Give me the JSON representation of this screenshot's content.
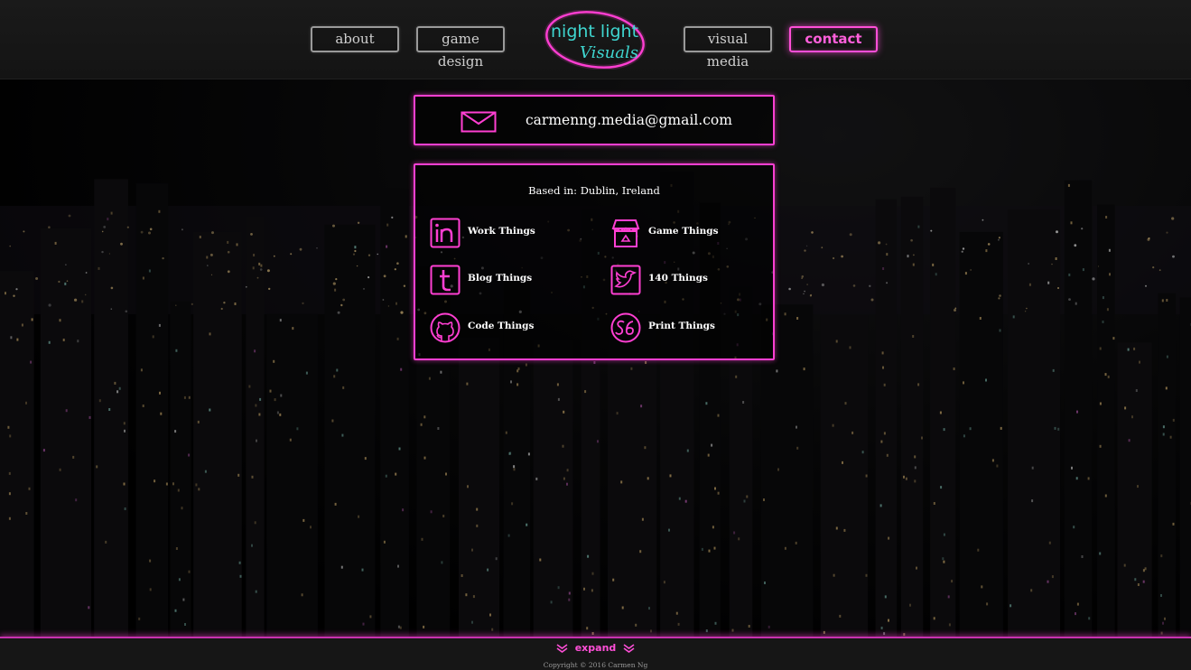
{
  "nav": {
    "left": [
      {
        "label": "about"
      },
      {
        "label": "game design"
      }
    ],
    "right": [
      {
        "label": "visual media"
      },
      {
        "label": "contact"
      }
    ],
    "logo": {
      "line1": "night light",
      "line2": "Visuals"
    }
  },
  "contact": {
    "email": "carmenng.media@gmail.com",
    "based": "Based in: Dublin, Ireland",
    "links": [
      {
        "label": "Work Things",
        "icon": "linkedin-icon"
      },
      {
        "label": "Game Things",
        "icon": "shop-icon"
      },
      {
        "label": "Blog Things",
        "icon": "tumblr-icon"
      },
      {
        "label": "140 Things",
        "icon": "twitter-icon"
      },
      {
        "label": "Code Things",
        "icon": "github-icon"
      },
      {
        "label": "Print Things",
        "icon": "society6-icon"
      }
    ]
  },
  "footer": {
    "expand": "expand",
    "copyright": "Copyright © 2016 Carmen Ng"
  },
  "colors": {
    "accent_pink": "#ff3fd2",
    "accent_teal": "#3fd6d0",
    "header_bg": "#1a1a1a"
  }
}
